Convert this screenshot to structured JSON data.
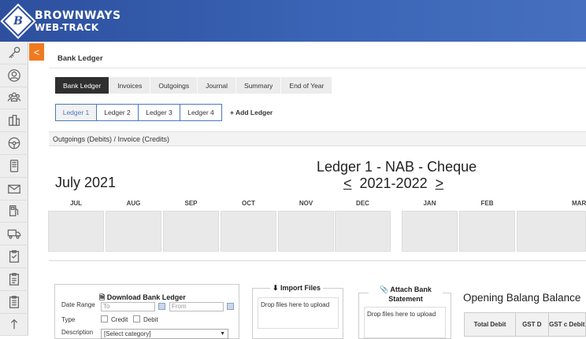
{
  "app": {
    "brand_line1": "BROWNWAYS",
    "brand_line2": "WEB-TRACK",
    "logo_letter": "B",
    "collapse_glyph": "<"
  },
  "sidebar": {
    "items": [
      {
        "icon": "key-icon"
      },
      {
        "icon": "user-icon"
      },
      {
        "icon": "users-icon"
      },
      {
        "icon": "buildings-icon"
      },
      {
        "icon": "steering-wheel-icon"
      },
      {
        "icon": "phone-icon"
      },
      {
        "icon": "envelope-icon"
      },
      {
        "icon": "fuel-pump-icon"
      },
      {
        "icon": "truck-icon"
      },
      {
        "icon": "clipboard-check-icon"
      },
      {
        "icon": "clipboard-icon"
      },
      {
        "icon": "clipboard-list-icon"
      },
      {
        "icon": "arrow-up-icon"
      }
    ]
  },
  "page": {
    "title": "Bank Ledger"
  },
  "tabs": [
    {
      "label": "Bank Ledger",
      "active": true
    },
    {
      "label": "Invoices",
      "active": false
    },
    {
      "label": "Outgoings",
      "active": false
    },
    {
      "label": "Journal",
      "active": false
    },
    {
      "label": "Summary",
      "active": false
    },
    {
      "label": "End of Year",
      "active": false
    }
  ],
  "ledger_tabs": [
    "Ledger 1",
    "Ledger 2",
    "Ledger 3",
    "Ledger 4"
  ],
  "add_ledger_label": "+ Add Ledger",
  "subheader": "Outgoings (Debits) / Invoice (Credits)",
  "period": {
    "month_title": "July 2021",
    "ledger_title": "Ledger 1 - NAB - Cheque",
    "prev_arrow": "<",
    "year": "2021-2022",
    "next_arrow": ">"
  },
  "months": [
    "JUL",
    "AUG",
    "SEP",
    "OCT",
    "NOV",
    "DEC",
    "JAN",
    "FEB",
    "MAR"
  ],
  "download": {
    "title": "Download Bank Ledger",
    "date_range_label": "Date Range",
    "to_placeholder": "To",
    "from_placeholder": "From",
    "type_label": "Type",
    "credit_label": "Credit",
    "debit_label": "Debit",
    "description_label": "Description",
    "category_value": "[Select category]"
  },
  "import_files": {
    "title": "Import Files",
    "drop_text": "Drop files here to upload"
  },
  "attach_statement": {
    "title_line1": "Attach Bank",
    "title_line2": "Statement",
    "drop_text": "Drop files here to upload"
  },
  "opening_balance": {
    "title": "Opening Balang Balance",
    "columns": [
      "Total Debit",
      "GST D",
      "GST c Debit"
    ]
  }
}
